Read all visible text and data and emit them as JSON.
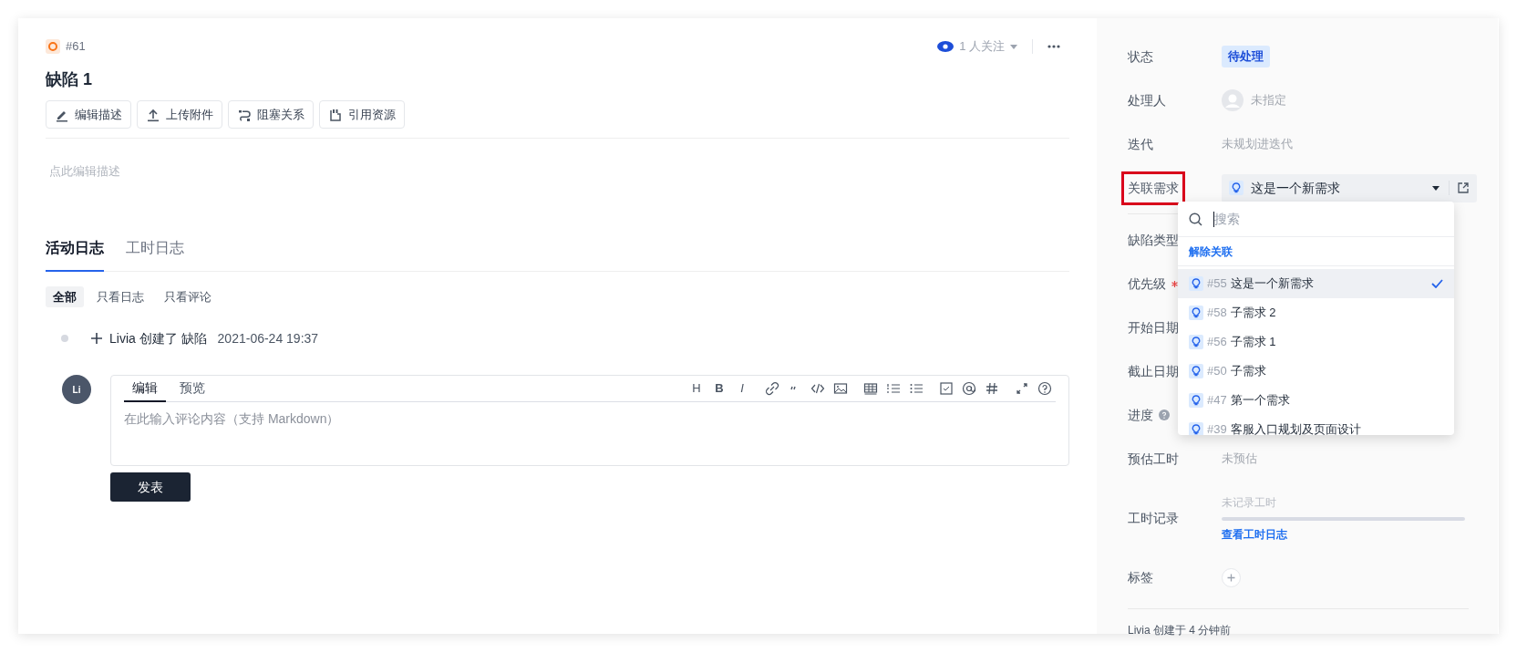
{
  "issue": {
    "number": "#61",
    "title": "缺陷 1"
  },
  "watch": {
    "label": "1 人关注"
  },
  "actions": [
    {
      "kind": "edit",
      "label": "编辑描述"
    },
    {
      "kind": "upload",
      "label": "上传附件"
    },
    {
      "kind": "block",
      "label": "阻塞关系"
    },
    {
      "kind": "cite",
      "label": "引用资源"
    }
  ],
  "description": {
    "placeholder": "点此编辑描述"
  },
  "tabs": [
    {
      "label": "活动日志",
      "selected": true
    },
    {
      "label": "工时日志",
      "selected": false
    }
  ],
  "filters": [
    {
      "label": "全部",
      "selected": true
    },
    {
      "label": "只看日志",
      "selected": false
    },
    {
      "label": "只看评论",
      "selected": false
    }
  ],
  "activity": [
    {
      "actor": "Livia",
      "action": "创建了",
      "target": "缺陷",
      "time": "2021-06-24 19:37"
    }
  ],
  "comment": {
    "avatar": "Li",
    "tabs": [
      {
        "label": "编辑",
        "selected": true
      },
      {
        "label": "预览",
        "selected": false
      }
    ],
    "toolbar_text": [
      "H",
      "B",
      "I"
    ],
    "placeholder": "在此输入评论内容（支持 Markdown）",
    "submit": "发表"
  },
  "fields": [
    {
      "kind": "status",
      "label": "状态",
      "value": "待处理"
    },
    {
      "kind": "assignee",
      "label": "处理人",
      "value": "未指定"
    },
    {
      "kind": "plain",
      "label": "迭代",
      "value": "未规划进迭代"
    },
    {
      "kind": "select",
      "label": "关联需求",
      "value": "这是一个新需求",
      "highlighted": true
    },
    {
      "kind": "covered",
      "label": "缺陷类型"
    },
    {
      "kind": "covered",
      "label": "优先级",
      "required": true
    },
    {
      "kind": "covered",
      "label": "开始日期"
    },
    {
      "kind": "covered",
      "label": "截止日期"
    },
    {
      "kind": "covered",
      "label": "进度",
      "help": true
    },
    {
      "kind": "plain",
      "label": "预估工时",
      "value": "未预估"
    },
    {
      "kind": "worklog",
      "label": "工时记录",
      "value": "未记录工时",
      "level": 0,
      "link": "查看工时日志"
    },
    {
      "kind": "tags",
      "label": "标签"
    }
  ],
  "footer": "Livia 创建于 4 分钟前",
  "dropdown": {
    "placeholder": "搜索",
    "unlink": "解除关联",
    "options": [
      {
        "number": "#55",
        "title": "这是一个新需求",
        "selected": true
      },
      {
        "number": "#58",
        "title": "子需求 2",
        "selected": false
      },
      {
        "number": "#56",
        "title": "子需求 1",
        "selected": false
      },
      {
        "number": "#50",
        "title": "子需求",
        "selected": false
      },
      {
        "number": "#47",
        "title": "第一个需求",
        "selected": false
      },
      {
        "number": "#39",
        "title": "客服入口规划及页面设计",
        "selected": false
      }
    ]
  }
}
